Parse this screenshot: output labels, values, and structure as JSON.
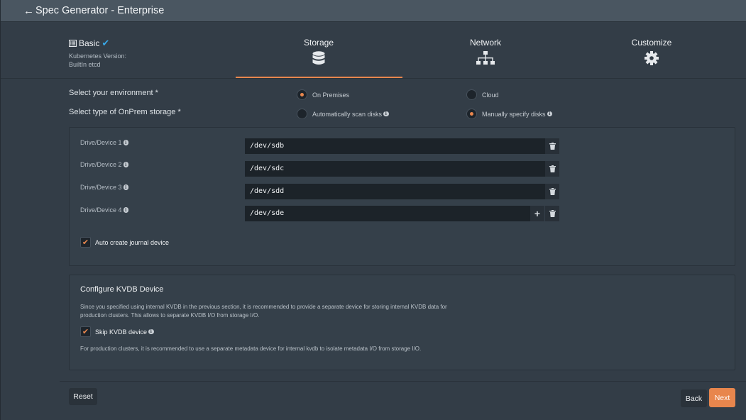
{
  "header": {
    "back_glyph": "←",
    "title": "Spec Generator - Enterprise"
  },
  "steps": {
    "basic": {
      "label": "Basic",
      "check": "✔",
      "sub_line1": "Kubernetes Version:",
      "sub_line2": "BuiltIn etcd",
      "icon": "list-icon"
    },
    "storage": {
      "label": "Storage",
      "icon": "database-icon"
    },
    "network": {
      "label": "Network",
      "icon": "network-icon"
    },
    "customize": {
      "label": "Customize",
      "icon": "gear-icon"
    }
  },
  "environment": {
    "label": "Select your environment *",
    "options": [
      {
        "label": "On Premises",
        "selected": true
      },
      {
        "label": "Cloud",
        "selected": false
      }
    ]
  },
  "storage_type": {
    "label": "Select type of OnPrem storage *",
    "options": [
      {
        "label": "Automatically scan disks",
        "selected": false
      },
      {
        "label": "Manually specify disks",
        "selected": true
      }
    ]
  },
  "drives": [
    {
      "label": "Drive/Device 1",
      "value": "/dev/sdb"
    },
    {
      "label": "Drive/Device 2",
      "value": "/dev/sdc"
    },
    {
      "label": "Drive/Device 3",
      "value": "/dev/sdd"
    },
    {
      "label": "Drive/Device 4",
      "value": "/dev/sde"
    }
  ],
  "info_glyph": "i",
  "add_glyph": "+",
  "auto_journal": {
    "label": "Auto create journal device",
    "checked": true,
    "glyph": "✔"
  },
  "kvdb": {
    "title": "Configure KVDB Device",
    "description": "Since you specified using internal KVDB in the previous section, it is recommended to provide a separate device for storing internal KVDB data for production clusters. This allows to separate KVDB I/O from storage I/O.",
    "skip_label": "Skip KVDB device",
    "skip_checked": true,
    "note": "For production clusters, it is recommended to use a separate metadata device for internal kvdb to isolate metadata I/O from storage I/O."
  },
  "footer": {
    "reset_label": "Reset",
    "back_label": "Back",
    "next_label": "Next"
  },
  "colors": {
    "accent": "#e8864d",
    "check_blue": "#39a9e8",
    "background": "#333d47",
    "header": "#4a5661"
  }
}
